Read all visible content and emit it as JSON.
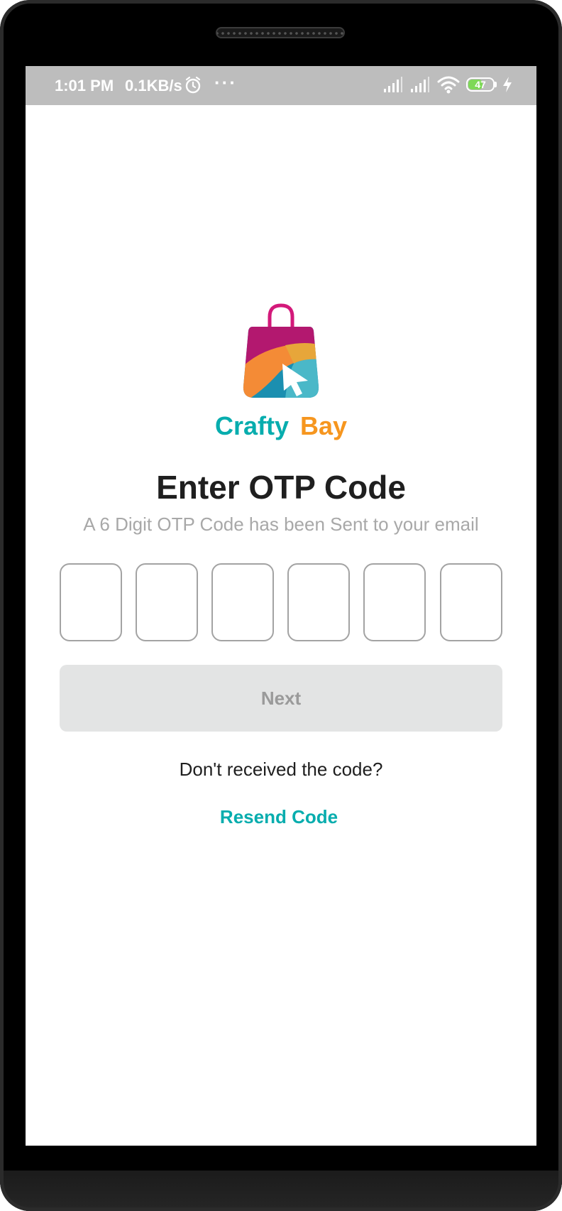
{
  "status_bar": {
    "time": "1:01 PM",
    "network_speed": "0.1KB/s",
    "more": "···",
    "battery": "47",
    "icons": [
      "alarm-icon",
      "signal-icon",
      "signal-icon",
      "wifi-icon",
      "battery-icon",
      "charging-bolt-icon"
    ]
  },
  "brand": {
    "logo_icon": "shopping-bag-cursor-icon",
    "name_part1": "Crafty",
    "name_part2": "Bay",
    "colors": {
      "teal": "#07adae",
      "orange": "#f6961f",
      "magenta": "#c8106f"
    }
  },
  "otp": {
    "title": "Enter OTP Code",
    "subtitle": "A 6 Digit OTP Code has been Sent to your email",
    "digits": [
      "",
      "",
      "",
      "",
      "",
      ""
    ]
  },
  "actions": {
    "next_label": "Next",
    "question": "Don't received the code?",
    "resend_label": "Resend Code"
  }
}
